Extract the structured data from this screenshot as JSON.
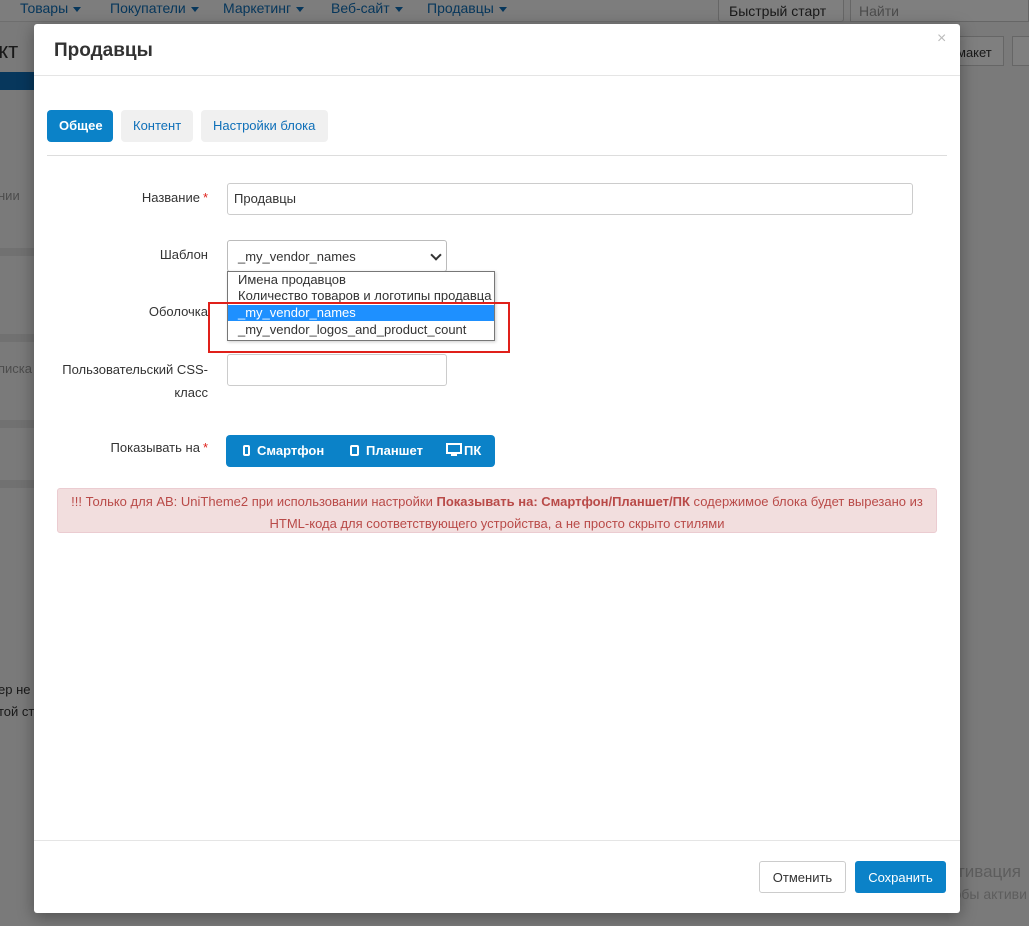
{
  "background": {
    "menu": [
      "Товары",
      "Покупатели",
      "Маркетинг",
      "Веб-сайт",
      "Продавцы"
    ],
    "quick_start": "Быстрый старт",
    "search_placeholder": "Найти",
    "page_heading_fragment": "акт",
    "right_button_fragment": "макет",
    "side_fragments": [
      "нии",
      "писка"
    ],
    "left_fragments": [
      "ер не",
      "той ст"
    ],
    "watermark_line1": "Активация",
    "watermark_line2": "Чтобы активи"
  },
  "modal": {
    "title": "Продавцы",
    "close_glyph": "×",
    "tabs": [
      {
        "label": "Общее",
        "active": true
      },
      {
        "label": "Контент",
        "active": false
      },
      {
        "label": "Настройки блока",
        "active": false
      }
    ],
    "form": {
      "name_label": "Название",
      "name_value": "Продавцы",
      "template_label": "Шаблон",
      "template_value": "_my_vendor_names",
      "template_options": [
        "Имена продавцов",
        "Количество товаров и логотипы продавца",
        "_my_vendor_names",
        "_my_vendor_logos_and_product_count"
      ],
      "template_selected_index": 2,
      "wrapper_label": "Оболочка",
      "css_label_line1": "Пользовательский CSS-",
      "css_label_line2": "класс",
      "css_value": "",
      "show_on_label": "Показывать на",
      "required_mark": "*",
      "devices": [
        "Смартфон",
        "Планшет",
        "ПК"
      ]
    },
    "alert": {
      "prefix": "!!! Только для АВ: UniTheme2 при использовании настройки",
      "bold": "Показывать на: Смартфон/Планшет/ПК",
      "suffix": "содержимое блока будет вырезано из HTML-кода для соответствующего устройства, а не просто скрыто стилями"
    },
    "buttons": {
      "cancel": "Отменить",
      "save": "Сохранить"
    }
  },
  "colors": {
    "primary": "#0b82c8",
    "highlight_frame": "#e0201a",
    "selected_option": "#1e90ff",
    "alert_bg": "#f2dede",
    "alert_text": "#b94a48"
  }
}
